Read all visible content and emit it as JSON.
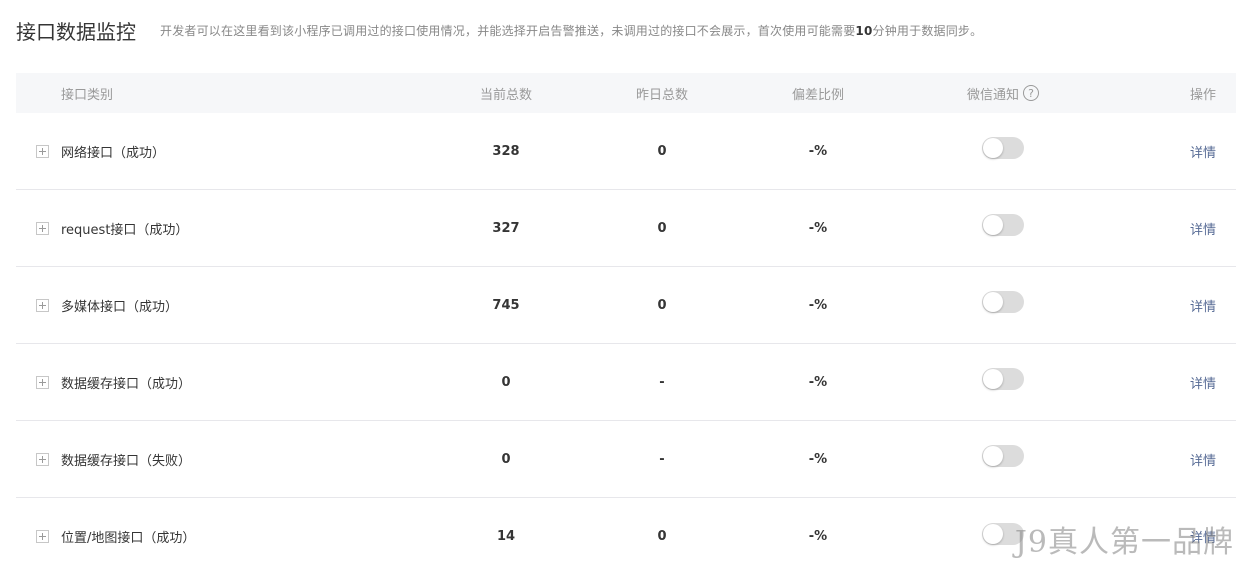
{
  "header": {
    "title": "接口数据监控",
    "description_before": "开发者可以在这里看到该小程序已调用过的接口使用情况，并能选择开启告警推送，未调用过的接口不会展示，首次使用可能需要",
    "description_bold": "10",
    "description_after": "分钟用于数据同步。"
  },
  "table": {
    "columns": {
      "type": "接口类别",
      "current_total": "当前总数",
      "yesterday_total": "昨日总数",
      "deviation": "偏差比例",
      "wechat_notify": "微信通知",
      "actions": "操作"
    },
    "help_icon_glyph": "?",
    "rows": [
      {
        "type": "网络接口（成功）",
        "current_total": "328",
        "yesterday_total": "0",
        "deviation": "-%",
        "notify_on": false,
        "action": "详情"
      },
      {
        "type": "request接口（成功）",
        "current_total": "327",
        "yesterday_total": "0",
        "deviation": "-%",
        "notify_on": false,
        "action": "详情"
      },
      {
        "type": "多媒体接口（成功）",
        "current_total": "745",
        "yesterday_total": "0",
        "deviation": "-%",
        "notify_on": false,
        "action": "详情"
      },
      {
        "type": "数据缓存接口（成功）",
        "current_total": "0",
        "yesterday_total": "-",
        "deviation": "-%",
        "notify_on": false,
        "action": "详情"
      },
      {
        "type": "数据缓存接口（失败）",
        "current_total": "0",
        "yesterday_total": "-",
        "deviation": "-%",
        "notify_on": false,
        "action": "详情"
      },
      {
        "type": "位置/地图接口（成功）",
        "current_total": "14",
        "yesterday_total": "0",
        "deviation": "-%",
        "notify_on": false,
        "action": "详情"
      }
    ]
  },
  "watermark": "J9真人第一品牌",
  "colors": {
    "link": "#576b95",
    "toggle_off": "#dcdcdc",
    "header_bg": "#f6f7f9"
  }
}
